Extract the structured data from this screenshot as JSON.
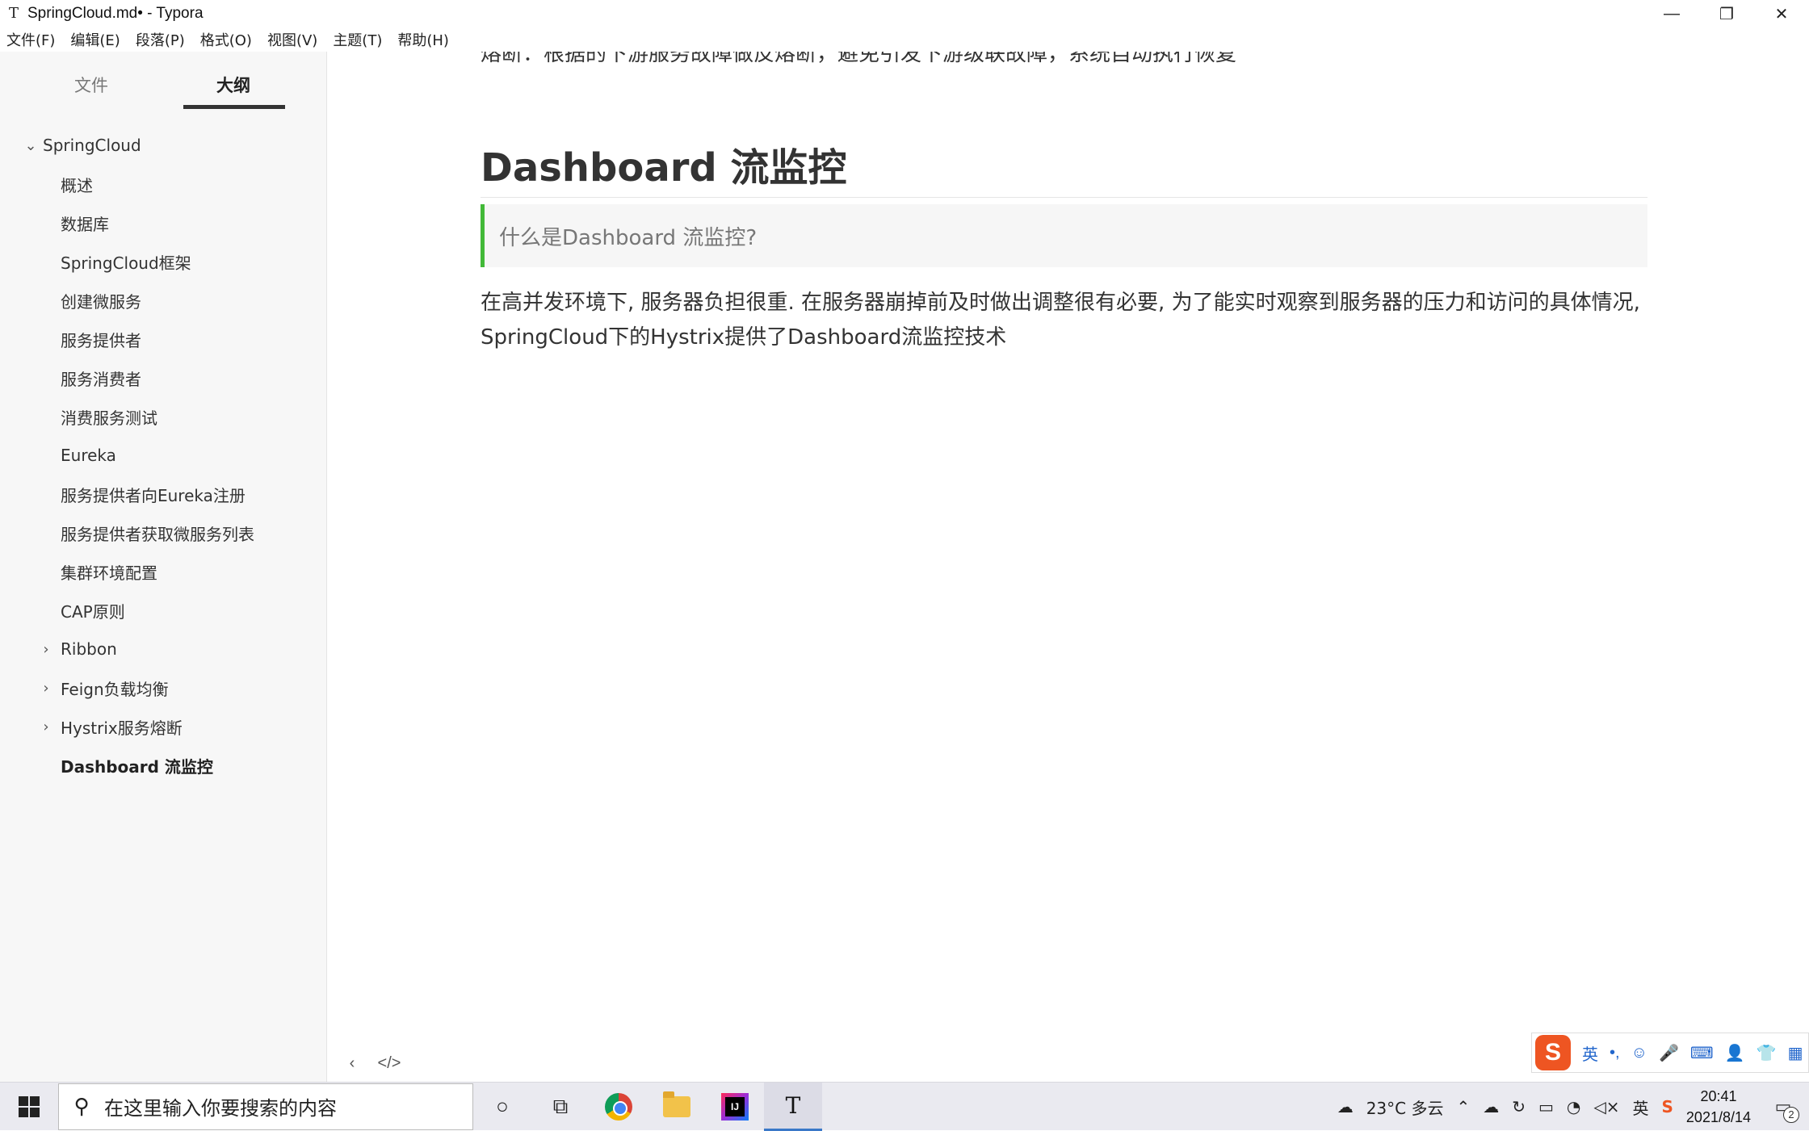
{
  "window": {
    "title": "SpringCloud.md• - Typora",
    "app_icon": "T",
    "controls": [
      "—",
      "❐",
      "✕"
    ]
  },
  "menu": [
    "文件(F)",
    "编辑(E)",
    "段落(P)",
    "格式(O)",
    "视图(V)",
    "主题(T)",
    "帮助(H)"
  ],
  "sidebar": {
    "tab_files": "文件",
    "tab_outline": "大纲",
    "active_tab": "大纲",
    "items": [
      {
        "label": "SpringCloud",
        "level": 1,
        "chevron": "⌄"
      },
      {
        "label": "概述",
        "level": 2,
        "chevron": ""
      },
      {
        "label": "数据库",
        "level": 2,
        "chevron": ""
      },
      {
        "label": "SpringCloud框架",
        "level": 2,
        "chevron": ""
      },
      {
        "label": "创建微服务",
        "level": 2,
        "chevron": ""
      },
      {
        "label": "服务提供者",
        "level": 2,
        "chevron": ""
      },
      {
        "label": "服务消费者",
        "level": 2,
        "chevron": ""
      },
      {
        "label": "消费服务测试",
        "level": 2,
        "chevron": ""
      },
      {
        "label": "Eureka",
        "level": 2,
        "chevron": ""
      },
      {
        "label": "服务提供者向Eureka注册",
        "level": 2,
        "chevron": ""
      },
      {
        "label": "服务提供者获取微服务列表",
        "level": 2,
        "chevron": ""
      },
      {
        "label": "集群环境配置",
        "level": 2,
        "chevron": ""
      },
      {
        "label": "CAP原则",
        "level": 2,
        "chevron": ""
      },
      {
        "label": "Ribbon",
        "level": 2,
        "chevron": "›"
      },
      {
        "label": "Feign负载均衡",
        "level": 2,
        "chevron": "›"
      },
      {
        "label": "Hystrix服务熔断",
        "level": 2,
        "chevron": "›"
      },
      {
        "label": "Dashboard 流监控",
        "level": 2,
        "chevron": "",
        "active": true
      }
    ],
    "bottom_back": "‹",
    "bottom_source": "</>"
  },
  "editor": {
    "cut_line": "熔断：根据的下游服务故障做反熔断，避免引发下游级联故障，系统自动执行恢复",
    "heading": "Dashboard 流监控",
    "quote": "什么是Dashboard 流监控?",
    "paragraph": "在高并发环境下, 服务器负担很重. 在服务器崩掉前及时做出调整很有必要, 为了能实时观察到服务器的压力和访问的具体情况, SpringCloud下的Hystrix提供了Dashboard流监控技术"
  },
  "ime": {
    "logo": "S",
    "items": [
      "英",
      "•,",
      "☺",
      "🎤",
      "⌨",
      "👤",
      "👕",
      "▦"
    ]
  },
  "taskbar": {
    "search_placeholder": "在这里输入你要搜索的内容",
    "weather": "23°C  多云",
    "time": "20:41",
    "date": "2021/8/14",
    "notification_count": "2",
    "ime_indicator": "英"
  },
  "colors": {
    "quote_bar": "#42b938",
    "sidebar_bg": "#f7f7f7",
    "taskbar_bg": "#eaeaf0"
  }
}
